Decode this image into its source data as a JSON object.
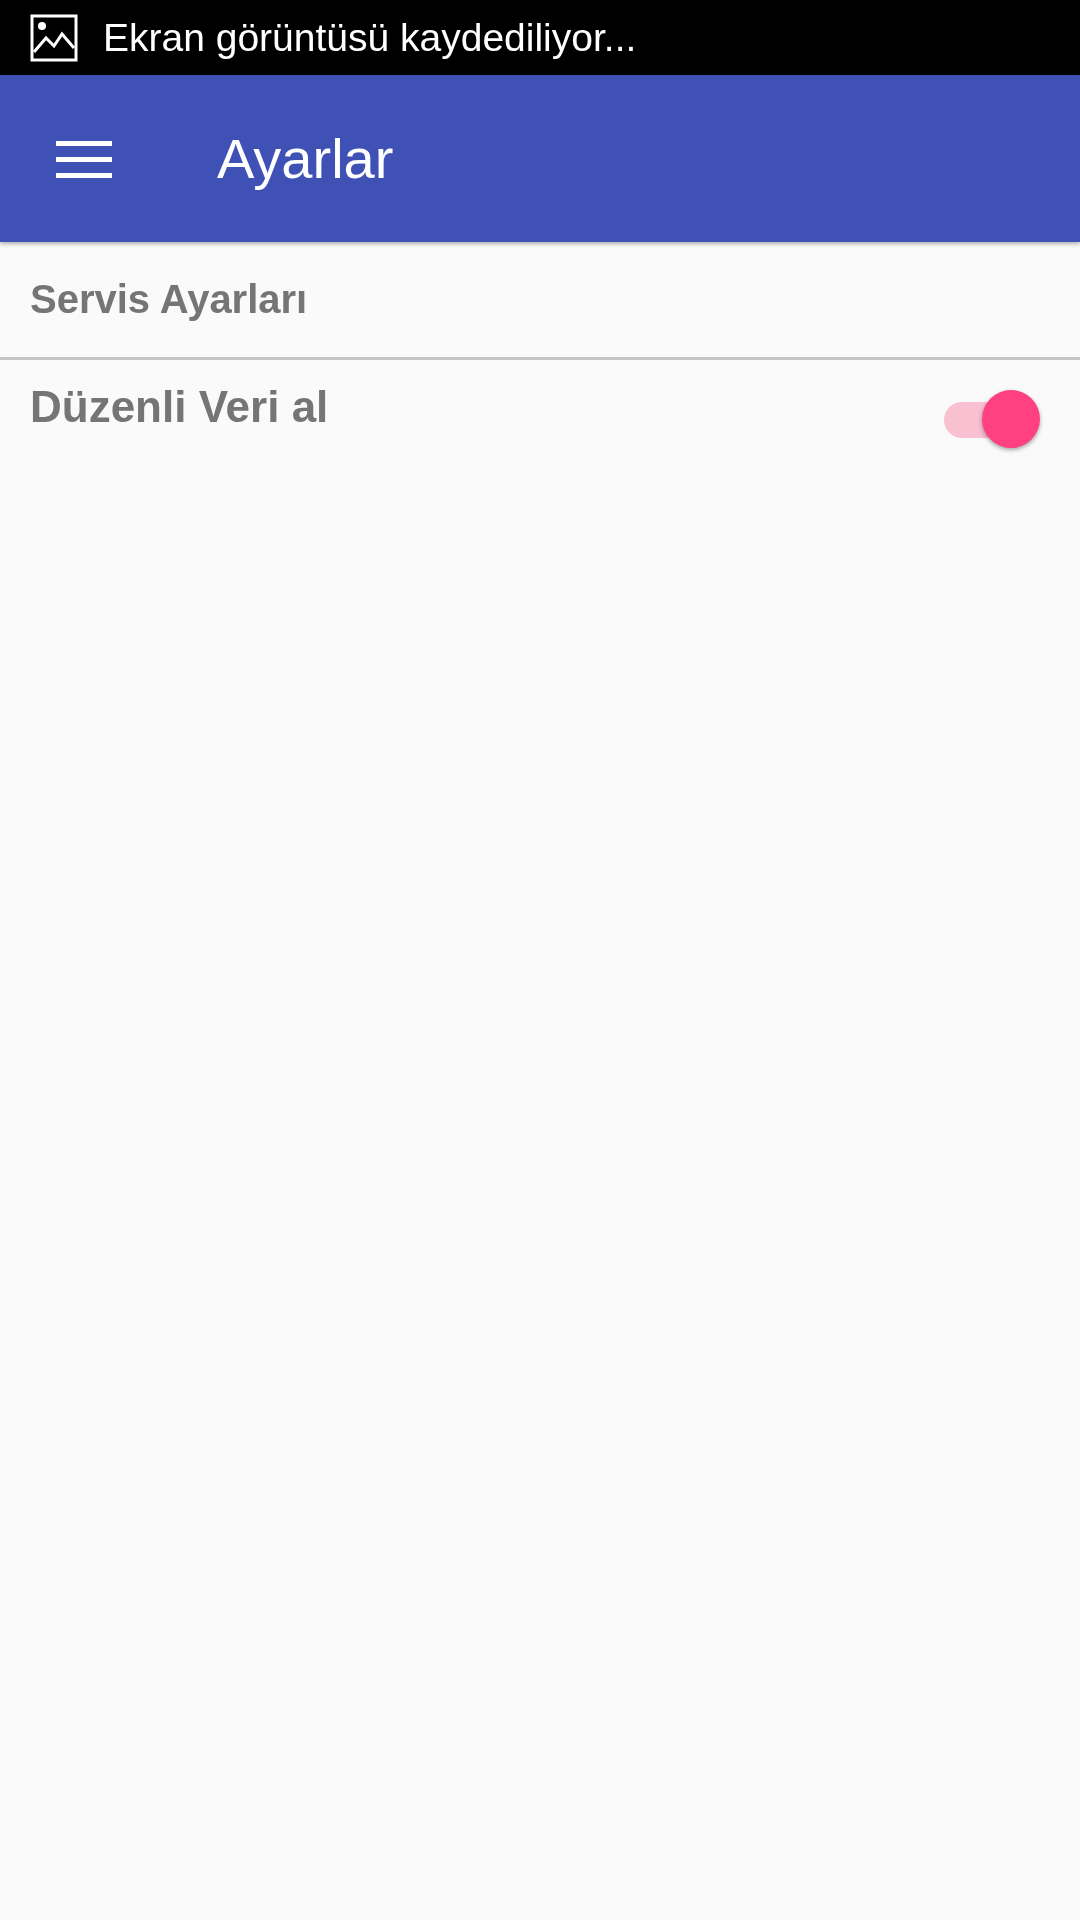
{
  "status_bar": {
    "notification": "Ekran görüntüsü kaydediliyor..."
  },
  "app_bar": {
    "title": "Ayarlar"
  },
  "sections": [
    {
      "title": "Servis Ayarları",
      "items": [
        {
          "label": "Düzenli Veri al",
          "kind": "switch",
          "on": true
        }
      ]
    }
  ]
}
